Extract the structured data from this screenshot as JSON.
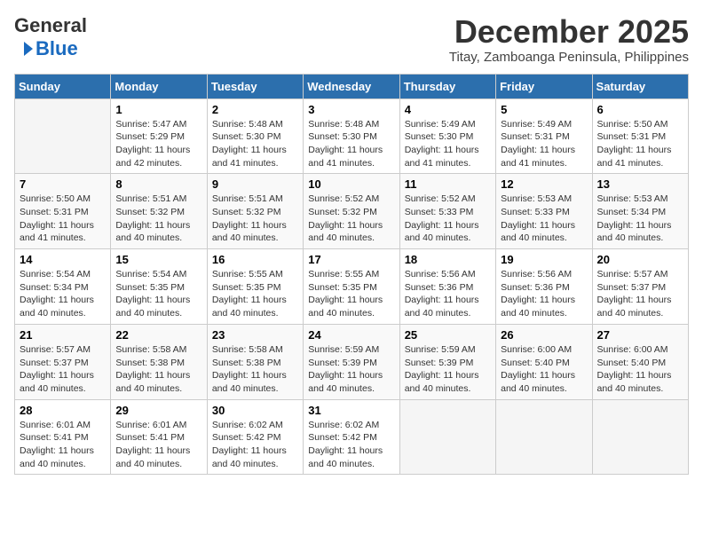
{
  "header": {
    "logo_general": "General",
    "logo_blue": "Blue",
    "month_title": "December 2025",
    "subtitle": "Titay, Zamboanga Peninsula, Philippines"
  },
  "days_of_week": [
    "Sunday",
    "Monday",
    "Tuesday",
    "Wednesday",
    "Thursday",
    "Friday",
    "Saturday"
  ],
  "weeks": [
    [
      {
        "day": "",
        "info": ""
      },
      {
        "day": "1",
        "info": "Sunrise: 5:47 AM\nSunset: 5:29 PM\nDaylight: 11 hours\nand 42 minutes."
      },
      {
        "day": "2",
        "info": "Sunrise: 5:48 AM\nSunset: 5:30 PM\nDaylight: 11 hours\nand 41 minutes."
      },
      {
        "day": "3",
        "info": "Sunrise: 5:48 AM\nSunset: 5:30 PM\nDaylight: 11 hours\nand 41 minutes."
      },
      {
        "day": "4",
        "info": "Sunrise: 5:49 AM\nSunset: 5:30 PM\nDaylight: 11 hours\nand 41 minutes."
      },
      {
        "day": "5",
        "info": "Sunrise: 5:49 AM\nSunset: 5:31 PM\nDaylight: 11 hours\nand 41 minutes."
      },
      {
        "day": "6",
        "info": "Sunrise: 5:50 AM\nSunset: 5:31 PM\nDaylight: 11 hours\nand 41 minutes."
      }
    ],
    [
      {
        "day": "7",
        "info": "Sunrise: 5:50 AM\nSunset: 5:31 PM\nDaylight: 11 hours\nand 41 minutes."
      },
      {
        "day": "8",
        "info": "Sunrise: 5:51 AM\nSunset: 5:32 PM\nDaylight: 11 hours\nand 40 minutes."
      },
      {
        "day": "9",
        "info": "Sunrise: 5:51 AM\nSunset: 5:32 PM\nDaylight: 11 hours\nand 40 minutes."
      },
      {
        "day": "10",
        "info": "Sunrise: 5:52 AM\nSunset: 5:32 PM\nDaylight: 11 hours\nand 40 minutes."
      },
      {
        "day": "11",
        "info": "Sunrise: 5:52 AM\nSunset: 5:33 PM\nDaylight: 11 hours\nand 40 minutes."
      },
      {
        "day": "12",
        "info": "Sunrise: 5:53 AM\nSunset: 5:33 PM\nDaylight: 11 hours\nand 40 minutes."
      },
      {
        "day": "13",
        "info": "Sunrise: 5:53 AM\nSunset: 5:34 PM\nDaylight: 11 hours\nand 40 minutes."
      }
    ],
    [
      {
        "day": "14",
        "info": "Sunrise: 5:54 AM\nSunset: 5:34 PM\nDaylight: 11 hours\nand 40 minutes."
      },
      {
        "day": "15",
        "info": "Sunrise: 5:54 AM\nSunset: 5:35 PM\nDaylight: 11 hours\nand 40 minutes."
      },
      {
        "day": "16",
        "info": "Sunrise: 5:55 AM\nSunset: 5:35 PM\nDaylight: 11 hours\nand 40 minutes."
      },
      {
        "day": "17",
        "info": "Sunrise: 5:55 AM\nSunset: 5:35 PM\nDaylight: 11 hours\nand 40 minutes."
      },
      {
        "day": "18",
        "info": "Sunrise: 5:56 AM\nSunset: 5:36 PM\nDaylight: 11 hours\nand 40 minutes."
      },
      {
        "day": "19",
        "info": "Sunrise: 5:56 AM\nSunset: 5:36 PM\nDaylight: 11 hours\nand 40 minutes."
      },
      {
        "day": "20",
        "info": "Sunrise: 5:57 AM\nSunset: 5:37 PM\nDaylight: 11 hours\nand 40 minutes."
      }
    ],
    [
      {
        "day": "21",
        "info": "Sunrise: 5:57 AM\nSunset: 5:37 PM\nDaylight: 11 hours\nand 40 minutes."
      },
      {
        "day": "22",
        "info": "Sunrise: 5:58 AM\nSunset: 5:38 PM\nDaylight: 11 hours\nand 40 minutes."
      },
      {
        "day": "23",
        "info": "Sunrise: 5:58 AM\nSunset: 5:38 PM\nDaylight: 11 hours\nand 40 minutes."
      },
      {
        "day": "24",
        "info": "Sunrise: 5:59 AM\nSunset: 5:39 PM\nDaylight: 11 hours\nand 40 minutes."
      },
      {
        "day": "25",
        "info": "Sunrise: 5:59 AM\nSunset: 5:39 PM\nDaylight: 11 hours\nand 40 minutes."
      },
      {
        "day": "26",
        "info": "Sunrise: 6:00 AM\nSunset: 5:40 PM\nDaylight: 11 hours\nand 40 minutes."
      },
      {
        "day": "27",
        "info": "Sunrise: 6:00 AM\nSunset: 5:40 PM\nDaylight: 11 hours\nand 40 minutes."
      }
    ],
    [
      {
        "day": "28",
        "info": "Sunrise: 6:01 AM\nSunset: 5:41 PM\nDaylight: 11 hours\nand 40 minutes."
      },
      {
        "day": "29",
        "info": "Sunrise: 6:01 AM\nSunset: 5:41 PM\nDaylight: 11 hours\nand 40 minutes."
      },
      {
        "day": "30",
        "info": "Sunrise: 6:02 AM\nSunset: 5:42 PM\nDaylight: 11 hours\nand 40 minutes."
      },
      {
        "day": "31",
        "info": "Sunrise: 6:02 AM\nSunset: 5:42 PM\nDaylight: 11 hours\nand 40 minutes."
      },
      {
        "day": "",
        "info": ""
      },
      {
        "day": "",
        "info": ""
      },
      {
        "day": "",
        "info": ""
      }
    ]
  ]
}
